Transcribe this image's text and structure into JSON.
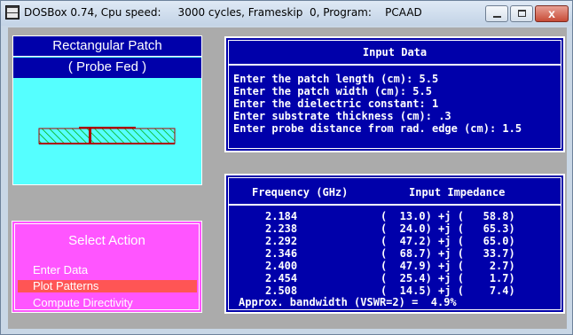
{
  "window": {
    "title": "DOSBox 0.74, Cpu speed:     3000 cycles, Frameskip  0, Program:    PCAAD",
    "icon": "dosbox-icon",
    "close_label": "x"
  },
  "colors": {
    "dos_blue": "#0000aa",
    "cyan": "#55ffff",
    "magenta": "#ff55ff",
    "highlight": "#ff5555",
    "screen_gray": "#ababab"
  },
  "patch_panel": {
    "title": "Rectangular Patch",
    "subtitle": "( Probe Fed )"
  },
  "menu": {
    "title": "Select Action",
    "items": [
      {
        "label": "Enter Data",
        "selected": false
      },
      {
        "label": "Plot Patterns",
        "selected": true
      },
      {
        "label": "Compute Directivity",
        "selected": false
      }
    ]
  },
  "input_data": {
    "header": "Input Data",
    "lines": [
      "Enter the patch length (cm): 5.5",
      "Enter the patch width (cm): 5.5",
      "Enter the dielectric constant: 1",
      "Enter substrate thickness (cm): .3",
      "Enter probe distance from rad. edge (cm): 1.5"
    ]
  },
  "impedance": {
    "col_frequency": "Frequency (GHz)",
    "col_impedance": "Input Impedance",
    "rows": [
      {
        "freq": "2.184",
        "z": "(  13.0) +j (   58.8)"
      },
      {
        "freq": "2.238",
        "z": "(  24.0) +j (   65.3)"
      },
      {
        "freq": "2.292",
        "z": "(  47.2) +j (   65.0)"
      },
      {
        "freq": "2.346",
        "z": "(  68.7) +j (   33.7)"
      },
      {
        "freq": "2.400",
        "z": "(  47.9) +j (    2.7)"
      },
      {
        "freq": "2.454",
        "z": "(  25.4) +j (    1.7)"
      },
      {
        "freq": "2.508",
        "z": "(  14.5) +j (    7.4)"
      }
    ],
    "bandwidth_line": "Approx. bandwidth (VSWR=2) =  4.9%"
  }
}
